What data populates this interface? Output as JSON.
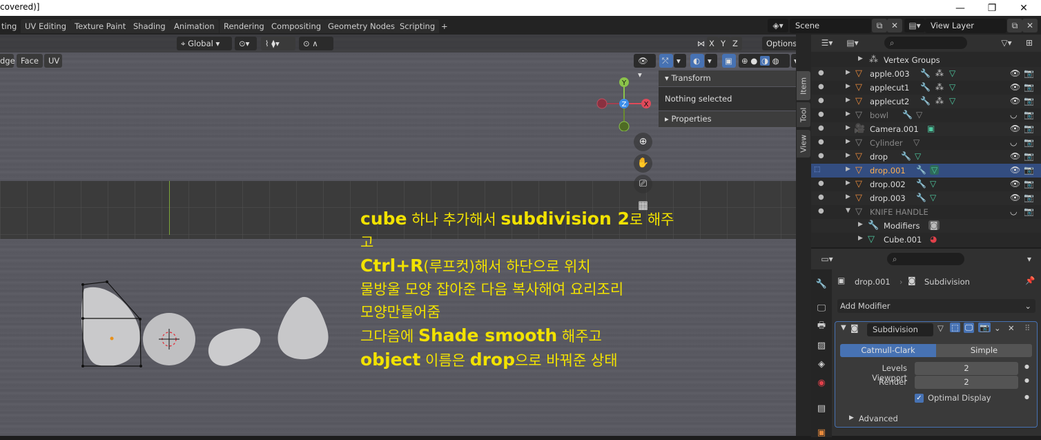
{
  "window": {
    "title": "covered)]",
    "minimize": "—",
    "maximize": "❐",
    "close": "✕"
  },
  "workspace_tabs": [
    "ting",
    "UV Editing",
    "Texture Paint",
    "Shading",
    "Animation",
    "Rendering",
    "Compositing",
    "Geometry Nodes",
    "Scripting"
  ],
  "add_tab": "+",
  "scene": {
    "name": "Scene"
  },
  "view_layer": {
    "name": "View Layer"
  },
  "viewport": {
    "select_modes": [
      "dge",
      "Face",
      "UV"
    ],
    "transform_orientation": "Global",
    "options_label": "Options",
    "axis_labels": {
      "x": "X",
      "y": "Y",
      "z": "Z"
    },
    "gizmo": {
      "x": "X",
      "y": "Y",
      "z": "Z"
    }
  },
  "annotation": {
    "line1_a": "cube",
    "line1_b": " 하나 추가해서 ",
    "line1_c": "subdivision 2",
    "line1_d": "로 해주",
    "line2": "고",
    "line3_a": "Ctrl+R",
    "line3_b": "(루프컷)해서 하단으로 위치",
    "line4": "물방울 모양 잡아준 다음 복사해여 요리조리",
    "line5": "모양만들어줌",
    "line6_a": "그다음에 ",
    "line6_b": "Shade smooth",
    "line6_c": " 해주고",
    "line7_a": "object",
    "line7_b": " 이름은 ",
    "line7_c": "drop",
    "line7_d": "으로 바꿔준 상태"
  },
  "npanel": {
    "transform_header": "Transform",
    "nothing_selected": "Nothing selected",
    "properties_header": "Properties",
    "tabs": [
      "Item",
      "Tool",
      "View"
    ]
  },
  "outliner": {
    "rows": [
      {
        "label": "Vertex Groups",
        "kind": "vgroup"
      },
      {
        "label": "apple.003",
        "kind": "mesh"
      },
      {
        "label": "applecut1",
        "kind": "mesh"
      },
      {
        "label": "applecut2",
        "kind": "mesh"
      },
      {
        "label": "bowl",
        "kind": "mesh-hidden"
      },
      {
        "label": "Camera.001",
        "kind": "camera"
      },
      {
        "label": "Cylinder",
        "kind": "mesh-hidden"
      },
      {
        "label": "drop",
        "kind": "mesh"
      },
      {
        "label": "drop.001",
        "kind": "mesh-selected"
      },
      {
        "label": "drop.002",
        "kind": "mesh"
      },
      {
        "label": "drop.003",
        "kind": "mesh"
      },
      {
        "label": "KNIFE HANDLE",
        "kind": "mesh-hidden"
      },
      {
        "label": "Modifiers",
        "kind": "child"
      },
      {
        "label": "Cube.001",
        "kind": "child"
      }
    ]
  },
  "properties": {
    "object_name": "drop.001",
    "modifier_breadcrumb": "Subdivision",
    "add_modifier": "Add Modifier",
    "modifier": {
      "name": "Subdivision",
      "mode_catmull": "Catmull-Clark",
      "mode_simple": "Simple",
      "levels_viewport_label": "Levels Viewport",
      "levels_viewport": "2",
      "render_label": "Render",
      "render": "2",
      "optimal_display": "Optimal Display",
      "advanced": "Advanced"
    }
  },
  "colors": {
    "accent": "#4772b3",
    "annotation": "#f2e200",
    "selected_row": "#334d80",
    "mesh_icon": "#e88a3c",
    "data_icon": "#4ec9a0"
  }
}
